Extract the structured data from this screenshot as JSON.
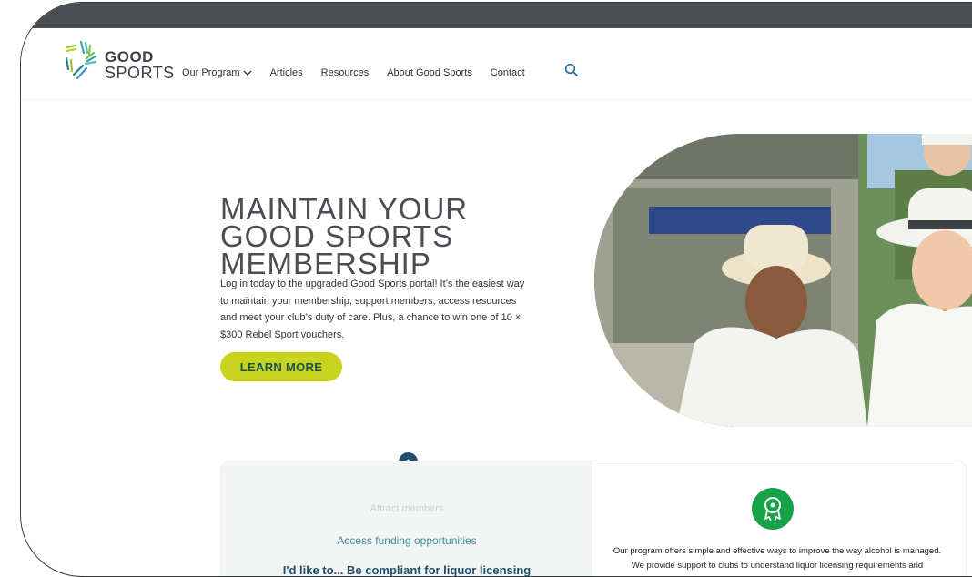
{
  "brand": {
    "line1": "GOOD",
    "line2": "SPORTS"
  },
  "nav": {
    "items": [
      {
        "label": "Our Program"
      },
      {
        "label": "Articles"
      },
      {
        "label": "Resources"
      },
      {
        "label": "About Good Sports"
      },
      {
        "label": "Contact"
      }
    ]
  },
  "hero": {
    "title_lines": [
      "MAINTAIN YOUR",
      "GOOD SPORTS",
      "MEMBERSHIP"
    ],
    "body": "Log in today to the upgraded Good Sports portal! It’s the easiest way to maintain your membership, support members, access resources and meet your club’s duty of care. Plus, a chance to win one of 10 × $300 Rebel Sport vouchers.",
    "cta_label": "LEARN MORE"
  },
  "picker": {
    "options": [
      "Attract members",
      "Access funding opportunities",
      "I'd like to... Be compliant for liquor licensing"
    ]
  },
  "info_card": {
    "text": "Our program offers simple and effective ways to improve the way alcohol is managed. We provide support to clubs to understand liquor licensing requirements and regulations."
  },
  "colors": {
    "accent_lime": "#c7d31c",
    "navy": "#1d4f6e",
    "teal": "#3f8a99",
    "green_badge": "#17a24a",
    "topbar": "#4a4d52"
  },
  "icons": [
    "chevron-down-icon",
    "search-icon",
    "chevron-up-icon",
    "award-ribbon-icon"
  ]
}
